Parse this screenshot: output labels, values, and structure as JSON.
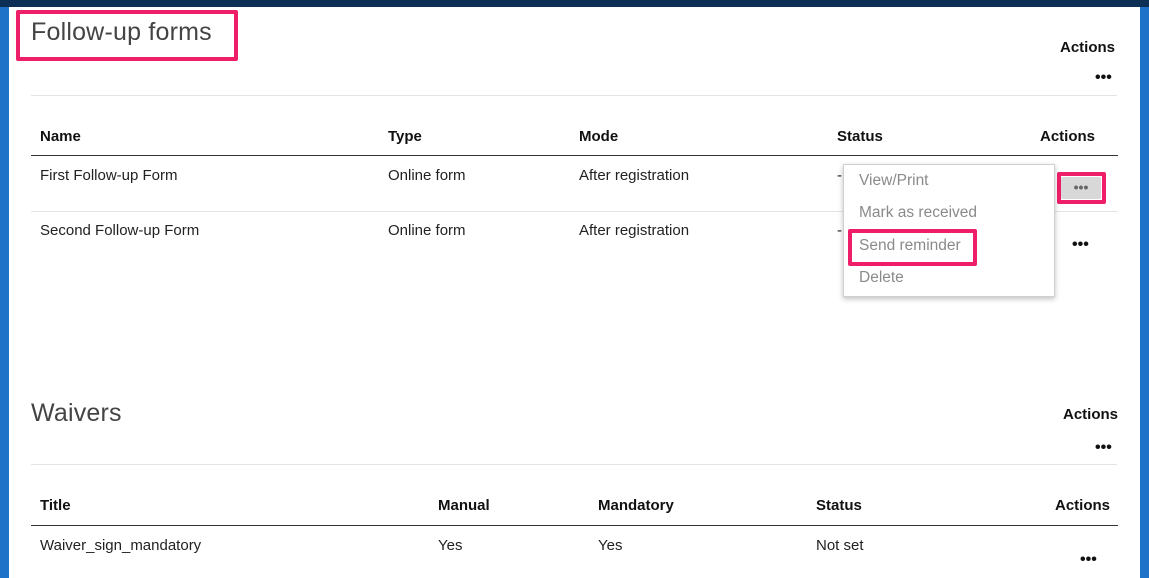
{
  "followup": {
    "title": "Follow-up forms",
    "actions_label": "Actions",
    "more_label": "•••",
    "columns": [
      "Name",
      "Type",
      "Mode",
      "Status",
      "Actions"
    ],
    "rows": [
      {
        "name": "First Follow-up Form",
        "type": "Online form",
        "mode": "After registration",
        "status": "-"
      },
      {
        "name": "Second Follow-up Form",
        "type": "Online form",
        "mode": "After registration",
        "status": "-"
      }
    ]
  },
  "dropdown": {
    "items": [
      "View/Print",
      "Mark as received",
      "Send reminder",
      "Delete"
    ]
  },
  "waivers": {
    "title": "Waivers",
    "actions_label": "Actions",
    "more_label": "•••",
    "columns": [
      "Title",
      "Manual",
      "Mandatory",
      "Status",
      "Actions"
    ],
    "rows": [
      {
        "title": "Waiver_sign_mandatory",
        "manual": "Yes",
        "mandatory": "Yes",
        "status": "Not set"
      }
    ]
  },
  "colors": {
    "highlight": "#ee1f68",
    "frame": "#1e73c8",
    "topbar": "#0d2f55"
  }
}
